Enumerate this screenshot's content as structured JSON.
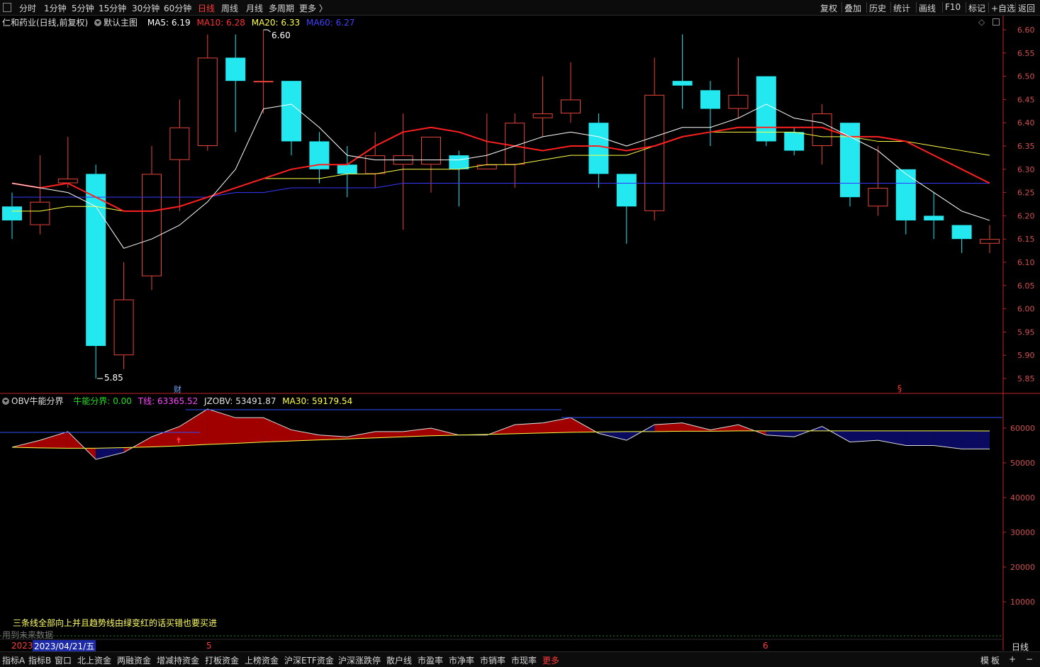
{
  "topbar": {
    "periods": [
      "分时",
      "1分钟",
      "5分钟",
      "15分钟",
      "30分钟",
      "60分钟",
      "日线",
      "周线",
      "月线",
      "多周期",
      "更多 〉"
    ],
    "active_period": "日线",
    "right_items": [
      "复权",
      "叠加",
      "历史",
      "统计",
      "画线",
      "F10",
      "标记",
      "+自选",
      "返回"
    ]
  },
  "main_legend": {
    "stock": "仁和药业(日线,前复权)",
    "template": "默认主图",
    "ma5": "MA5: 6.19",
    "ma10": "MA10: 6.28",
    "ma20": "MA20: 6.33",
    "ma60": "MA60: 6.27"
  },
  "sub_legend": {
    "name": "OBV牛能分界",
    "bull": "牛能分界: 0.00",
    "t": "T线: 63365.52",
    "jzobv": "JZOBV: 53491.87",
    "ma30": "MA30: 59179.54"
  },
  "annotations": {
    "high_label": "6.60",
    "low_label": "5.85",
    "cai_marker": "财",
    "s_marker": "§",
    "note": "三条线全部向上并且趋势线由绿变红的话买错也要买进",
    "future_data": "用到未来数据"
  },
  "date_bar": {
    "year_label": "2023",
    "cursor_date": "2023/04/21/五",
    "month_5": "5",
    "month_6": "6",
    "period_label": "日线"
  },
  "bottombar": {
    "tabs": [
      "指标A",
      "指标B",
      "窗口",
      "北上资金",
      "两融资金",
      "增减持资金",
      "打板资金",
      "上榜资金",
      "沪深ETF资金",
      "沪深涨跌停",
      "散户线",
      "市盈率",
      "市净率",
      "市销率",
      "市现率",
      "更多"
    ],
    "active_tab": "更多",
    "right_items": [
      "模",
      "板",
      "+",
      "−"
    ]
  },
  "colors": {
    "up": "#e8443a",
    "down": "#23e8f0",
    "ma5": "#ffffff",
    "ma10": "#ff2020",
    "ma20": "#ffff44",
    "ma60": "#3838ff",
    "axis": "#c0262a"
  },
  "chart_data": [
    {
      "type": "candlestick",
      "y_ticks": [
        "6.60",
        "6.55",
        "6.50",
        "6.45",
        "6.40",
        "6.35",
        "6.30",
        "6.25",
        "6.20",
        "6.15",
        "6.10",
        "6.05",
        "6.00",
        "5.95",
        "5.90",
        "5.85"
      ],
      "ylim": [
        5.84,
        6.615
      ],
      "candles": [
        {
          "o": 6.22,
          "c": 6.19,
          "h": 6.25,
          "l": 6.15
        },
        {
          "o": 6.18,
          "c": 6.23,
          "h": 6.33,
          "l": 6.16
        },
        {
          "o": 6.27,
          "c": 6.28,
          "h": 6.37,
          "l": 6.26
        },
        {
          "o": 6.29,
          "c": 5.92,
          "h": 6.31,
          "l": 5.85
        },
        {
          "o": 5.9,
          "c": 6.02,
          "h": 6.1,
          "l": 5.87
        },
        {
          "o": 6.07,
          "c": 6.29,
          "h": 6.35,
          "l": 6.04
        },
        {
          "o": 6.32,
          "c": 6.39,
          "h": 6.45,
          "l": 6.21
        },
        {
          "o": 6.35,
          "c": 6.54,
          "h": 6.59,
          "l": 6.34
        },
        {
          "o": 6.54,
          "c": 6.49,
          "h": 6.59,
          "l": 6.38
        },
        {
          "o": 6.49,
          "c": 6.49,
          "h": 6.6,
          "l": 6.42
        },
        {
          "o": 6.49,
          "c": 6.36,
          "h": 6.49,
          "l": 6.33
        },
        {
          "o": 6.36,
          "c": 6.3,
          "h": 6.38,
          "l": 6.27
        },
        {
          "o": 6.31,
          "c": 6.29,
          "h": 6.35,
          "l": 6.24
        },
        {
          "o": 6.29,
          "c": 6.33,
          "h": 6.38,
          "l": 6.26
        },
        {
          "o": 6.31,
          "c": 6.33,
          "h": 6.42,
          "l": 6.17
        },
        {
          "o": 6.31,
          "c": 6.37,
          "h": 6.37,
          "l": 6.25
        },
        {
          "o": 6.33,
          "c": 6.3,
          "h": 6.34,
          "l": 6.22
        },
        {
          "o": 6.3,
          "c": 6.31,
          "h": 6.42,
          "l": 6.3
        },
        {
          "o": 6.31,
          "c": 6.4,
          "h": 6.42,
          "l": 6.26
        },
        {
          "o": 6.41,
          "c": 6.42,
          "h": 6.5,
          "l": 6.37
        },
        {
          "o": 6.42,
          "c": 6.45,
          "h": 6.53,
          "l": 6.4
        },
        {
          "o": 6.4,
          "c": 6.29,
          "h": 6.42,
          "l": 6.26
        },
        {
          "o": 6.29,
          "c": 6.22,
          "h": 6.29,
          "l": 6.14
        },
        {
          "o": 6.21,
          "c": 6.46,
          "h": 6.54,
          "l": 6.19
        },
        {
          "o": 6.49,
          "c": 6.48,
          "h": 6.59,
          "l": 6.43
        },
        {
          "o": 6.47,
          "c": 6.43,
          "h": 6.49,
          "l": 6.35
        },
        {
          "o": 6.43,
          "c": 6.46,
          "h": 6.54,
          "l": 6.41
        },
        {
          "o": 6.5,
          "c": 6.36,
          "h": 6.5,
          "l": 6.35
        },
        {
          "o": 6.38,
          "c": 6.34,
          "h": 6.39,
          "l": 6.33
        },
        {
          "o": 6.35,
          "c": 6.42,
          "h": 6.44,
          "l": 6.31
        },
        {
          "o": 6.4,
          "c": 6.24,
          "h": 6.4,
          "l": 6.22
        },
        {
          "o": 6.22,
          "c": 6.26,
          "h": 6.35,
          "l": 6.2
        },
        {
          "o": 6.3,
          "c": 6.19,
          "h": 6.3,
          "l": 6.16
        },
        {
          "o": 6.2,
          "c": 6.19,
          "h": 6.25,
          "l": 6.15
        },
        {
          "o": 6.18,
          "c": 6.15,
          "h": 6.18,
          "l": 6.12
        },
        {
          "o": 6.14,
          "c": 6.15,
          "h": 6.18,
          "l": 6.12
        }
      ],
      "ma5": [
        6.27,
        6.26,
        6.25,
        6.22,
        6.13,
        6.15,
        6.18,
        6.23,
        6.3,
        6.43,
        6.44,
        6.39,
        6.33,
        6.32,
        6.32,
        6.32,
        6.32,
        6.33,
        6.35,
        6.37,
        6.38,
        6.37,
        6.35,
        6.37,
        6.39,
        6.39,
        6.41,
        6.44,
        6.41,
        6.4,
        6.37,
        6.34,
        6.29,
        6.25,
        6.21,
        6.19
      ],
      "ma10": [
        6.27,
        6.26,
        6.27,
        6.24,
        6.21,
        6.21,
        6.22,
        6.24,
        6.26,
        6.28,
        6.3,
        6.31,
        6.31,
        6.35,
        6.38,
        6.39,
        6.38,
        6.36,
        6.35,
        6.34,
        6.35,
        6.35,
        6.34,
        6.35,
        6.37,
        6.38,
        6.39,
        6.39,
        6.39,
        6.39,
        6.37,
        6.37,
        6.36,
        6.33,
        6.3,
        6.27
      ],
      "ma20": [
        6.21,
        6.21,
        6.22,
        6.22,
        6.21,
        6.21,
        6.22,
        6.24,
        6.26,
        6.28,
        6.28,
        6.28,
        6.29,
        6.29,
        6.3,
        6.3,
        6.3,
        6.31,
        6.31,
        6.32,
        6.33,
        6.33,
        6.33,
        6.35,
        6.37,
        6.38,
        6.38,
        6.38,
        6.38,
        6.37,
        6.37,
        6.36,
        6.36,
        6.35,
        6.34,
        6.33
      ],
      "ma60": [
        6.24,
        6.24,
        6.24,
        6.24,
        6.24,
        6.24,
        6.24,
        6.24,
        6.25,
        6.25,
        6.26,
        6.26,
        6.26,
        6.26,
        6.27,
        6.27,
        6.27,
        6.27,
        6.27,
        6.27,
        6.27,
        6.27,
        6.27,
        6.27,
        6.27,
        6.27,
        6.27,
        6.27,
        6.27,
        6.27,
        6.27,
        6.27,
        6.27,
        6.27,
        6.27,
        6.27
      ]
    },
    {
      "type": "area",
      "y_ticks": [
        "60000",
        "50000",
        "40000",
        "30000",
        "20000",
        "10000"
      ],
      "ylim": [
        0,
        70000
      ],
      "obv": [
        54500,
        56500,
        59000,
        51000,
        53000,
        57500,
        60500,
        65500,
        63000,
        63000,
        59500,
        58000,
        57500,
        59000,
        59000,
        60000,
        58000,
        58000,
        61000,
        61500,
        63000,
        58500,
        56500,
        61000,
        61500,
        59500,
        61000,
        58000,
        57500,
        60500,
        56000,
        56500,
        55000,
        55000,
        54000,
        54000
      ],
      "ma30": [
        54500,
        54300,
        54200,
        54200,
        54400,
        54600,
        54900,
        55300,
        55600,
        56000,
        56300,
        56600,
        56900,
        57200,
        57500,
        57800,
        58000,
        58200,
        58400,
        58600,
        58800,
        58900,
        59000,
        59000,
        59100,
        59100,
        59200,
        59200,
        59200,
        59200,
        59200,
        59200,
        59200,
        59200,
        59200,
        59179.54
      ],
      "t_line": 63365.52,
      "jzobv": 53491.87
    }
  ]
}
